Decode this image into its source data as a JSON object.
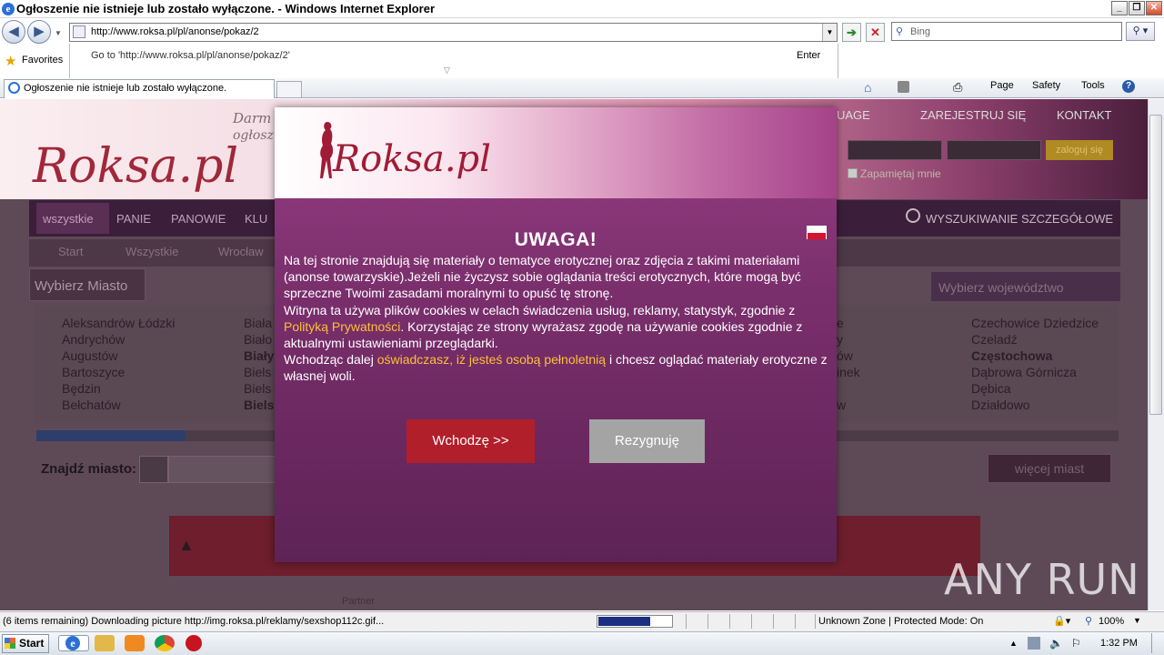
{
  "window": {
    "title": "Ogłoszenie nie istnieje lub zostało wyłączone. - Windows Internet Explorer",
    "minimize": "_",
    "maximize": "❐",
    "close": "✕"
  },
  "navigation": {
    "address": "http://www.roksa.pl/pl/anonse/pokaz/2",
    "search_placeholder": "Bing",
    "suggestion": "Go to 'http://www.roksa.pl/pl/anonse/pokaz/2'",
    "suggestion_action": "Enter"
  },
  "favorites": {
    "label": "Favorites"
  },
  "tab": {
    "title": "Ogłoszenie nie istnieje lub zostało wyłączone."
  },
  "command_bar": {
    "page": "Page",
    "safety": "Safety",
    "tools": "Tools"
  },
  "page": {
    "logo": "Roksa.pl",
    "tagline1": "Darm",
    "tagline2": "ogłosz",
    "header_links": [
      "UAGE",
      "ZAREJESTRUJ SIĘ",
      "KONTAKT"
    ],
    "login_button": "zaloguj się",
    "remember_me": "Zapamiętaj mnie",
    "menu": [
      "wszystkie",
      "PANIE",
      "PANOWIE",
      "KLU"
    ],
    "advanced_search": "WYSZUKIWANIE SZCZEGÓŁOWE",
    "breadcrumbs": [
      "Start",
      "Wszystkie",
      "Wrocław"
    ],
    "city_header": "Wybierz Miasto",
    "voivodeship": "Wybierz województwo",
    "cities_col1": [
      "Aleksandrów Łódzki",
      "Andrychów",
      "Augustów",
      "Bartoszyce",
      "Będzin",
      "Bełchatów"
    ],
    "cities_col2": [
      "Biała",
      "Biało",
      "Biały",
      "Biels",
      "Biels",
      "Biels"
    ],
    "cities_col3": [
      "e",
      "y",
      "ów",
      "inek",
      "",
      "w"
    ],
    "cities_col4": [
      "Czechowice Dziedzice",
      "Czeladź",
      "Częstochowa",
      "Dąbrowa Górnicza",
      "Dębica",
      "Działdowo"
    ],
    "find_city": "Znajdź miasto:",
    "more_cities": "więcej miast",
    "partner": "Partner"
  },
  "modal": {
    "logo": "Roksa.pl",
    "heading": "UWAGA!",
    "p1": "Na tej stronie znajdują się materiały o tematyce erotycznej oraz zdjęcia z takimi materiałami (anonse towarzyskie).Jeżeli nie życzysz sobie oglądania treści erotycznych, które mogą być sprzeczne Twoimi zasadami moralnymi to opuść tę stronę.",
    "p2_before": "Witryna ta używa plików cookies w celach świadczenia usług, reklamy, statystyk, zgodnie z ",
    "p2_link": "Polityką Prywatności",
    "p2_after": ". Korzystając ze strony wyrażasz zgodę na używanie cookies zgodnie z aktualnymi ustawieniami przeglądarki.",
    "p3_before": "Wchodząc dalej ",
    "p3_link": "oświadczasz, iż jesteś osobą pełnoletnią",
    "p3_after": " i chcesz oglądać materiały erotyczne z własnej woli.",
    "enter_button": "Wchodzę >>",
    "leave_button": "Rezygnuję"
  },
  "status": {
    "text": "(6 items remaining) Downloading picture http://img.roksa.pl/reklamy/sexshop112c.gif...",
    "progress": 0.69,
    "zone": "Unknown Zone | Protected Mode: On",
    "zoom": "100%"
  },
  "taskbar": {
    "start": "Start",
    "clock": "1:32 PM"
  },
  "watermark": "ANY RUN",
  "colors": {
    "modal_accent": "#b11f2b",
    "link_highlight": "#ffbf3a",
    "page_bg": "#5e4a57"
  }
}
